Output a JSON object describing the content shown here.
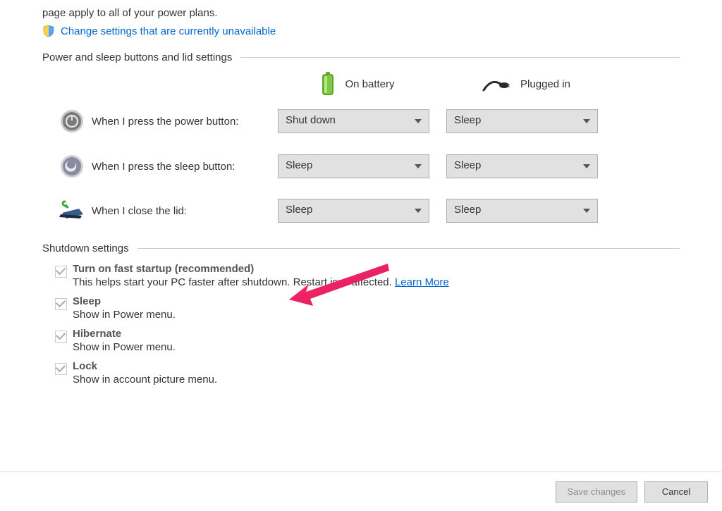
{
  "intro_fragment": "page apply to all of your power plans.",
  "change_link": "Change settings that are currently unavailable",
  "section_buttons": "Power and sleep buttons and lid settings",
  "columns": {
    "battery": "On battery",
    "plugged": "Plugged in"
  },
  "rows": {
    "power_button": {
      "label": "When I press the power button:",
      "battery": "Shut down",
      "plugged": "Sleep"
    },
    "sleep_button": {
      "label": "When I press the sleep button:",
      "battery": "Sleep",
      "plugged": "Sleep"
    },
    "close_lid": {
      "label": "When I close the lid:",
      "battery": "Sleep",
      "plugged": "Sleep"
    }
  },
  "section_shutdown": "Shutdown settings",
  "shutdown": {
    "fast_startup": {
      "label": "Turn on fast startup (recommended)",
      "desc": "This helps start your PC faster after shutdown. Restart isn't affected. ",
      "learn_more": "Learn More"
    },
    "sleep": {
      "label": "Sleep",
      "desc": "Show in Power menu."
    },
    "hibernate": {
      "label": "Hibernate",
      "desc": "Show in Power menu."
    },
    "lock": {
      "label": "Lock",
      "desc": "Show in account picture menu."
    }
  },
  "footer": {
    "save": "Save changes",
    "cancel": "Cancel"
  }
}
